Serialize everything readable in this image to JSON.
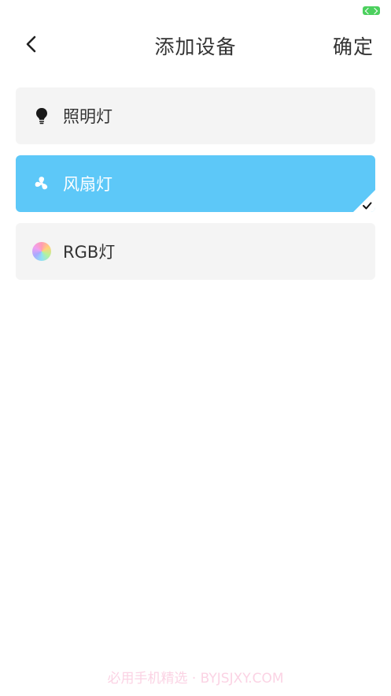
{
  "header": {
    "title": "添加设备",
    "confirm_label": "确定",
    "back_icon": "chevron-left-icon"
  },
  "devices": [
    {
      "label": "照明灯",
      "icon": "lightbulb-icon",
      "selected": false
    },
    {
      "label": "风扇灯",
      "icon": "fan-icon",
      "selected": true
    },
    {
      "label": "RGB灯",
      "icon": "rgb-color-wheel-icon",
      "selected": false
    }
  ],
  "colors": {
    "selected_bg": "#5dc8f8",
    "item_bg": "#f4f4f4",
    "text": "#333333",
    "status_green": "#4cd05e"
  },
  "watermark": "必用手机精选 · BYJSJXY.COM"
}
